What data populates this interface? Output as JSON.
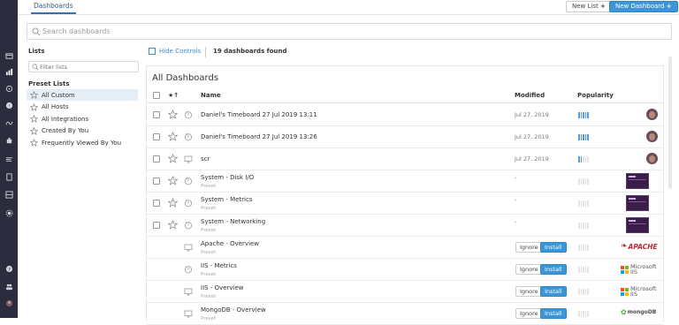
{
  "topbar": {
    "tab_label": "Dashboards",
    "new_list_label": "New List",
    "new_dashboard_label": "New Dashboard"
  },
  "search": {
    "placeholder": "Search dashboards"
  },
  "lists_panel": {
    "lists_heading": "Lists",
    "filter_placeholder": "Filter lists",
    "preset_heading": "Preset Lists",
    "presets": [
      {
        "label": "All Custom",
        "selected": true
      },
      {
        "label": "All Hosts",
        "selected": false
      },
      {
        "label": "All Integrations",
        "selected": false
      },
      {
        "label": "Created By You",
        "selected": false
      },
      {
        "label": "Frequently Viewed By You",
        "selected": false
      }
    ]
  },
  "controls": {
    "hide_controls_label": "Hide Controls",
    "found_text": "19 dashboards found"
  },
  "table": {
    "title": "All Dashboards",
    "columns": {
      "star": "★↑",
      "name": "Name",
      "modified": "Modified",
      "popularity": "Popularity"
    },
    "rows": [
      {
        "name": "Daniel's Timeboard 27 Jul 2019 13:11",
        "sub": "",
        "modified": "Jul 27, 2019",
        "popularity": 5,
        "type": "timeboard",
        "right": "avatar",
        "checkbox": true
      },
      {
        "name": "Daniel's Timeboard 27 Jul 2019 13:26",
        "sub": "",
        "modified": "Jul 27, 2019",
        "popularity": 5,
        "type": "timeboard",
        "right": "avatar",
        "checkbox": true
      },
      {
        "name": "scr",
        "sub": "",
        "modified": "Jul 27, 2019",
        "popularity": 2,
        "type": "screenboard",
        "right": "avatar",
        "checkbox": true
      },
      {
        "name": "System - Disk I/O",
        "sub": "Preset",
        "modified": "-",
        "popularity": 0,
        "type": "timeboard",
        "right": "thumbnail",
        "checkbox": true
      },
      {
        "name": "System - Metrics",
        "sub": "Preset",
        "modified": "-",
        "popularity": 0,
        "type": "timeboard",
        "right": "thumbnail",
        "checkbox": true
      },
      {
        "name": "System - Networking",
        "sub": "Preset",
        "modified": "-",
        "popularity": 0,
        "type": "timeboard",
        "right": "thumbnail",
        "checkbox": true
      },
      {
        "name": "Apache - Overview",
        "sub": "Preset",
        "modified": "",
        "popularity": 0,
        "type": "screenboard",
        "right": "apache",
        "checkbox": false,
        "ignore": "Ignore",
        "install": "Install"
      },
      {
        "name": "IIS - Metrics",
        "sub": "Preset",
        "modified": "",
        "popularity": 0,
        "type": "timeboard",
        "right": "microsoft",
        "checkbox": false,
        "ignore": "Ignore",
        "install": "Install"
      },
      {
        "name": "IIS - Overview",
        "sub": "Preset",
        "modified": "",
        "popularity": 0,
        "type": "screenboard",
        "right": "microsoft",
        "checkbox": false,
        "ignore": "Ignore",
        "install": "Install"
      },
      {
        "name": "MongoDB - Overview",
        "sub": "Preset",
        "modified": "",
        "popularity": 0,
        "type": "screenboard",
        "right": "mongodb",
        "checkbox": false,
        "ignore": "Ignore",
        "install": "Install"
      }
    ]
  },
  "logos": {
    "apache": "APACHE",
    "microsoft_line1": "Microsoft",
    "microsoft_line2": "IIS",
    "mongodb": "mongoDB"
  },
  "colors": {
    "rail": "#2b2d3f",
    "accent": "#3b95d6",
    "link": "#3b8ad0"
  },
  "rail_icons": [
    "dashboards-icon",
    "infrastructure-icon",
    "monitors-icon",
    "metrics-icon",
    "integrations-icon",
    "apm-icon",
    "logs-icon",
    "synthetics-icon",
    "security-icon",
    "settings-icon",
    "help-icon",
    "team-icon",
    "user-icon"
  ]
}
